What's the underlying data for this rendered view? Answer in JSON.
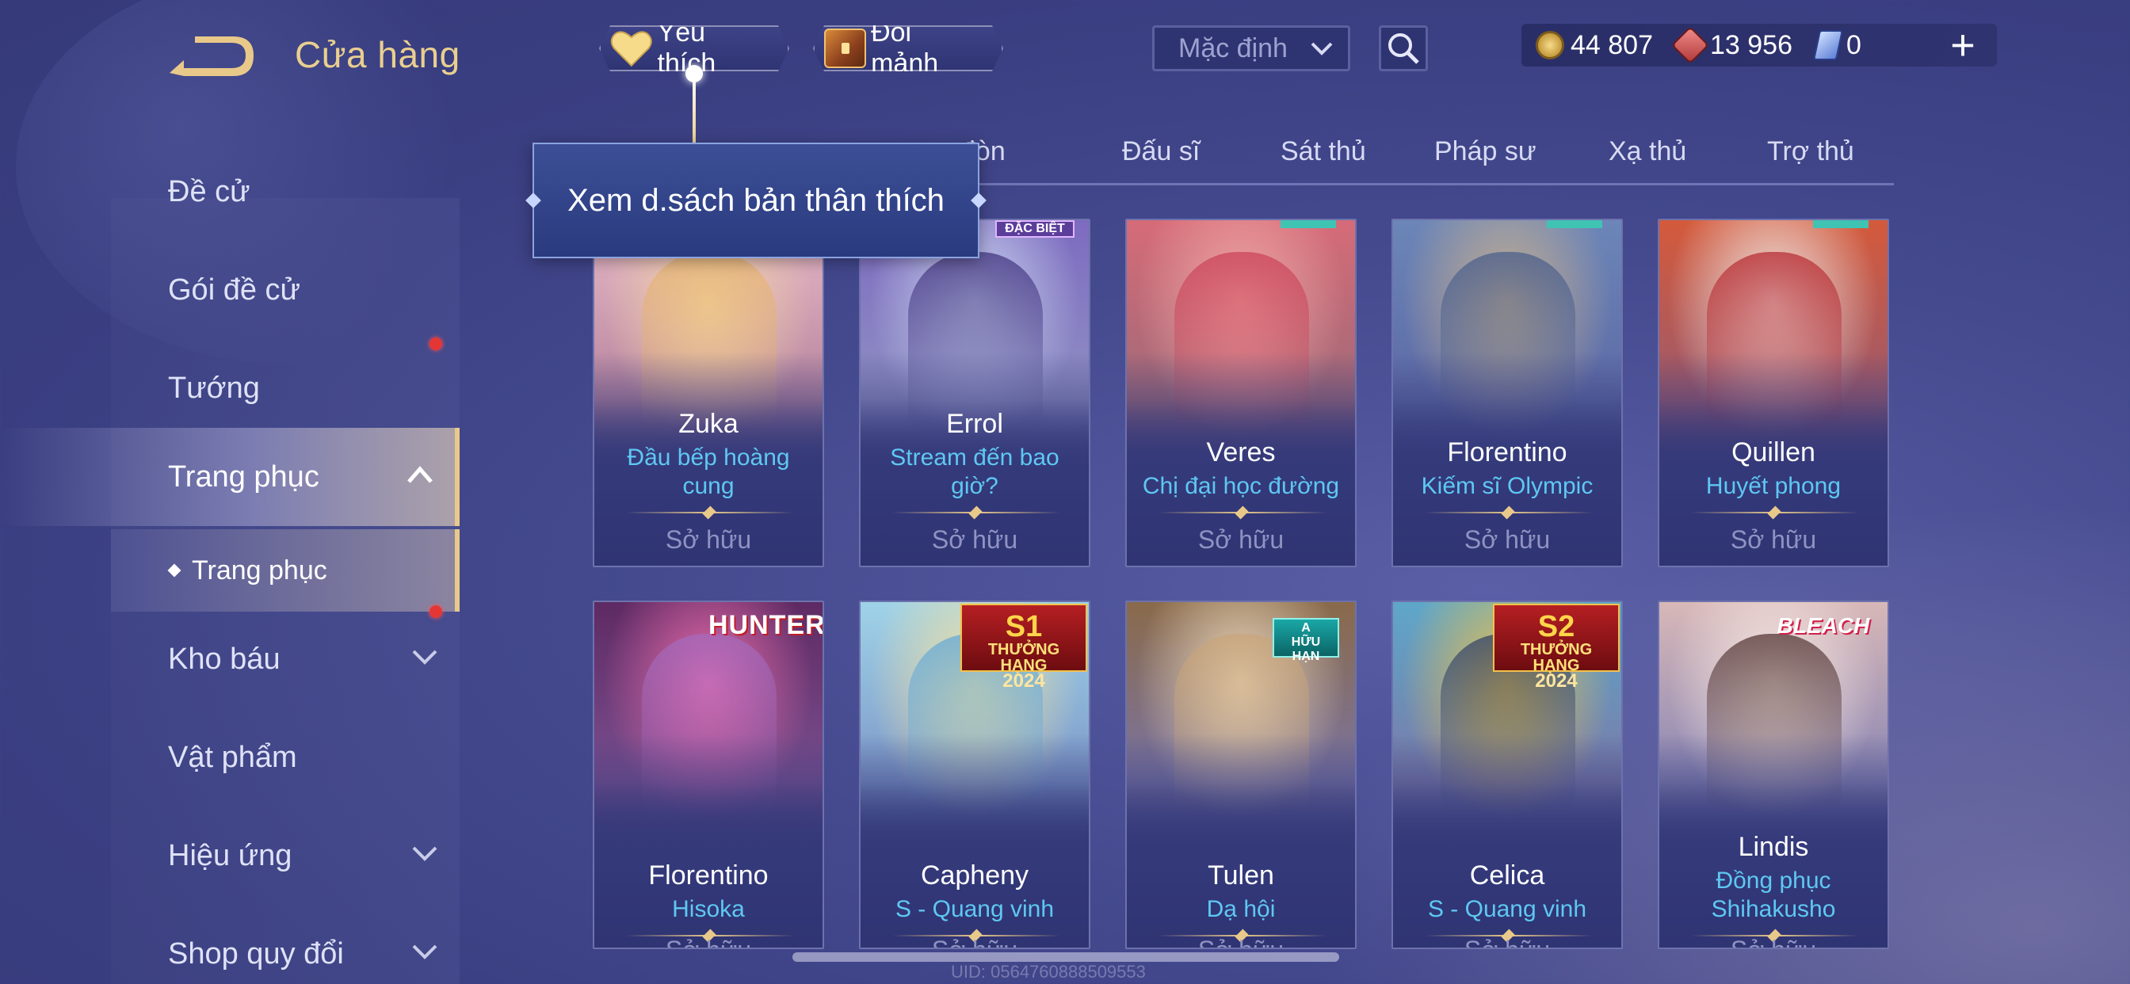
{
  "header": {
    "title": "Cửa hàng",
    "favorite_label": "Yêu thích",
    "swap_label": "Đổi mảnh",
    "sort_value": "Mặc định"
  },
  "currencies": [
    {
      "icon": "gold-coin-icon",
      "value": "44 807"
    },
    {
      "icon": "red-gem-icon",
      "value": "13 956"
    },
    {
      "icon": "voucher-icon",
      "value": "0"
    }
  ],
  "tooltip": "Xem d.sách bản thân thích",
  "sidebar": {
    "items": [
      {
        "label": "Đề cử"
      },
      {
        "label": "Gói đề cử"
      },
      {
        "label": "Tướng"
      },
      {
        "label": "Trang phục"
      },
      {
        "label": "Kho báu"
      },
      {
        "label": "Vật phẩm"
      },
      {
        "label": "Hiệu ứng"
      },
      {
        "label": "Shop quy đổi"
      }
    ],
    "sub_item": "Trang phục"
  },
  "tabs": [
    {
      "label": "đòn"
    },
    {
      "label": "Đấu sĩ"
    },
    {
      "label": "Sát thủ"
    },
    {
      "label": "Pháp sư"
    },
    {
      "label": "Xạ thủ"
    },
    {
      "label": "Trợ thủ"
    }
  ],
  "cards": [
    {
      "hero": "Zuka",
      "skin": "Đầu bếp hoàng cung",
      "status": "Sở hữu"
    },
    {
      "hero": "Errol",
      "skin": "Stream đến bao giờ?",
      "status": "Sở hữu",
      "badge": "ĐẶC BIỆT"
    },
    {
      "hero": "Veres",
      "skin": "Chị đại học đường",
      "status": "Sở hữu"
    },
    {
      "hero": "Florentino",
      "skin": "Kiếm sĩ Olympic",
      "status": "Sở hữu"
    },
    {
      "hero": "Quillen",
      "skin": "Huyết phong",
      "status": "Sở hữu"
    },
    {
      "hero": "Florentino",
      "skin": "Hisoka",
      "status": "Sở hữu",
      "badge": "HUNTER"
    },
    {
      "hero": "Capheny",
      "skin": "S - Quang vinh",
      "status": "Sở hữu",
      "badge": "S1",
      "badge_sub": "THƯỞNG HẠNG",
      "badge_year": "2024"
    },
    {
      "hero": "Tulen",
      "skin": "Dạ hội",
      "status": "Sở hữu",
      "badge": "A",
      "badge_sub": "HỮU HẠN"
    },
    {
      "hero": "Celica",
      "skin": "S - Quang vinh",
      "status": "Sở hữu",
      "badge": "S2",
      "badge_sub": "THƯỞNG HẠNG",
      "badge_year": "2024"
    },
    {
      "hero": "Lindis",
      "skin": "Đồng phục Shihakusho",
      "status": "Sở hữu",
      "badge": "BLEACH"
    }
  ],
  "uid": "UID: 0564760888509553",
  "colors": {
    "accent_gold": "#e9cf8f",
    "skin_blue": "#5ec8f2",
    "badge_red": "#b51f22"
  }
}
